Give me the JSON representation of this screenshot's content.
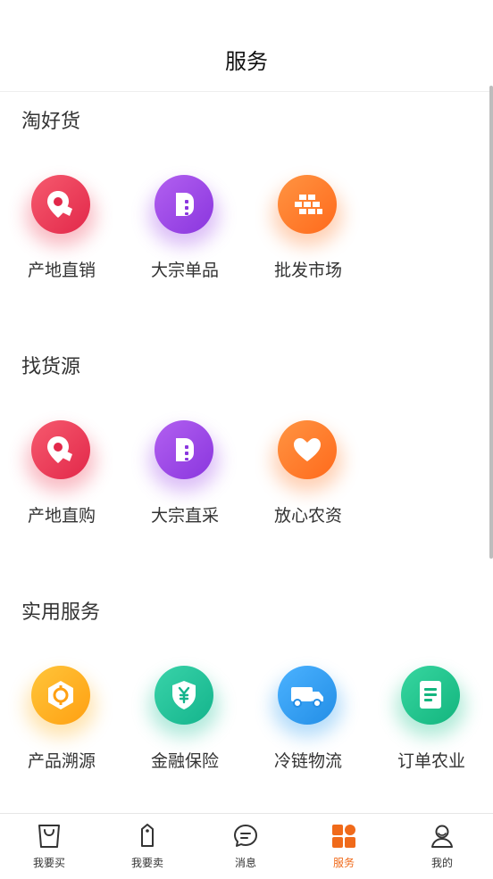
{
  "header": {
    "title": "服务"
  },
  "sections": [
    {
      "title": "淘好货",
      "items": [
        {
          "label": "产地直销",
          "icon": "location-pin-icon",
          "color": "#ee3f58"
        },
        {
          "label": "大宗单品",
          "icon": "bulk-bag-icon",
          "color": "#9b47e8"
        },
        {
          "label": "批发市场",
          "icon": "bricks-icon",
          "color": "#ff7a2a"
        }
      ]
    },
    {
      "title": "找货源",
      "items": [
        {
          "label": "产地直购",
          "icon": "location-pin-icon",
          "color": "#ee3f58"
        },
        {
          "label": "大宗直采",
          "icon": "bulk-bag-icon",
          "color": "#9b47e8"
        },
        {
          "label": "放心农资",
          "icon": "heart-icon",
          "color": "#ff7a2a"
        }
      ]
    },
    {
      "title": "实用服务",
      "items": [
        {
          "label": "产品溯源",
          "icon": "target-icon",
          "color": "#ffb21f"
        },
        {
          "label": "金融保险",
          "icon": "yuan-shield-icon",
          "color": "#21c29a"
        },
        {
          "label": "冷链物流",
          "icon": "truck-icon",
          "color": "#2c9df0"
        },
        {
          "label": "订单农业",
          "icon": "clipboard-icon",
          "color": "#1ec58f"
        }
      ]
    }
  ],
  "tabbar": {
    "active_color": "#f06a1a",
    "items": [
      {
        "label": "我要买",
        "icon": "shopping-bag-icon"
      },
      {
        "label": "我要卖",
        "icon": "price-tag-icon"
      },
      {
        "label": "消息",
        "icon": "chat-bubble-icon"
      },
      {
        "label": "服务",
        "icon": "grid-icon",
        "active": true
      },
      {
        "label": "我的",
        "icon": "user-icon"
      }
    ]
  }
}
